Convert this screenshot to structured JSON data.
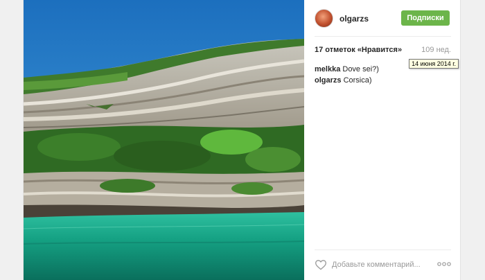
{
  "post": {
    "username": "olgarzs",
    "follow_label": "Подписки",
    "likes_text": "17 отметок «Нравится»",
    "age_text": "109 нед.",
    "tooltip_text": "14 июня 2014 г.",
    "comments": [
      {
        "user": "melkka",
        "text": "Dove sei?)"
      },
      {
        "user": "olgarzs",
        "text": "Corsica)"
      }
    ],
    "comment_placeholder": "Добавьте комментарий...",
    "colors": {
      "follow_button": "#6cb54a",
      "sky": "#2a7db8",
      "sea": "#1aa384"
    }
  }
}
